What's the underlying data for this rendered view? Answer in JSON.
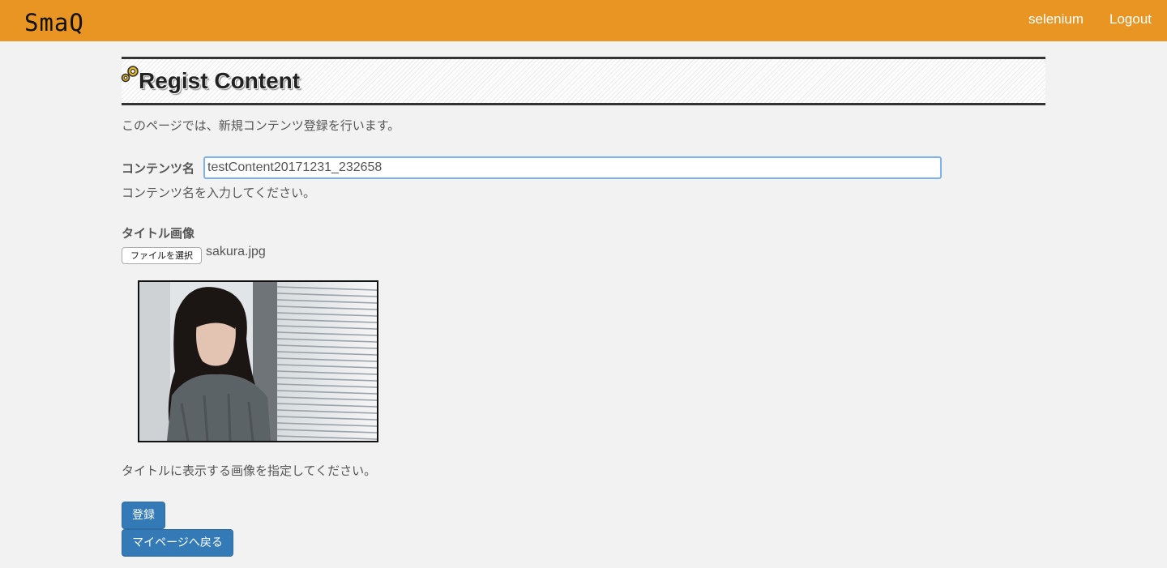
{
  "navbar": {
    "brand": "SmaQ",
    "user": "selenium",
    "logout": "Logout"
  },
  "header": {
    "title": "Regist Content"
  },
  "intro": "このページでは、新規コンテンツ登録を行います。",
  "form": {
    "content_name_label": "コンテンツ名",
    "content_name_value": "testContent20171231_232658",
    "content_name_help": "コンテンツ名を入力してください。",
    "title_image_label": "タイトル画像",
    "file_button_label": "ファイルを選択",
    "file_name": "sakura.jpg",
    "title_image_help": "タイトルに表示する画像を指定してください。"
  },
  "buttons": {
    "submit": "登録",
    "back": "マイページへ戻る"
  },
  "colors": {
    "navbar": "#e89524",
    "primary_button": "#337ab7",
    "focus_border": "#7cb3ee"
  }
}
